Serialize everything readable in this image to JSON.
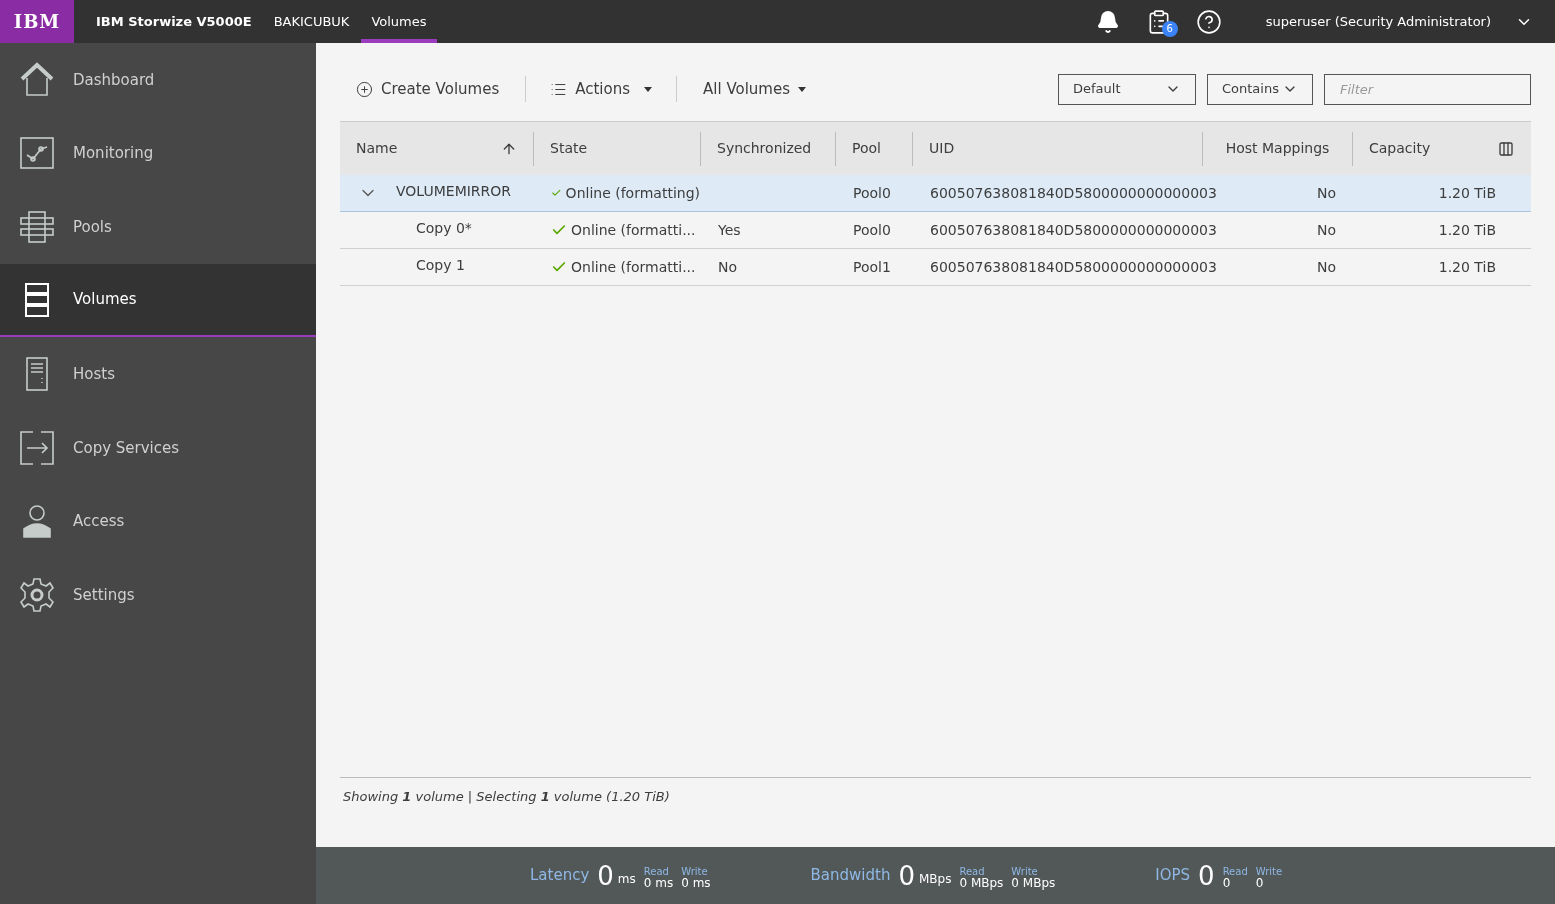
{
  "header": {
    "logo": "IBM",
    "product": "IBM Storwize V5000E",
    "system": "BAKICUBUK",
    "tabs": [
      {
        "label": "Volumes",
        "selected": true
      }
    ],
    "tasks_badge": "6",
    "user": "superuser (Security Administrator)"
  },
  "sidebar": {
    "items": [
      {
        "label": "Dashboard",
        "kind": "dashboard",
        "selected": false
      },
      {
        "label": "Monitoring",
        "kind": "monitoring",
        "selected": false
      },
      {
        "label": "Pools",
        "kind": "pools",
        "selected": false
      },
      {
        "label": "Volumes",
        "kind": "volumes",
        "selected": true
      },
      {
        "label": "Hosts",
        "kind": "hosts",
        "selected": false
      },
      {
        "label": "Copy Services",
        "kind": "copy",
        "selected": false
      },
      {
        "label": "Access",
        "kind": "access",
        "selected": false
      },
      {
        "label": "Settings",
        "kind": "settings",
        "selected": false
      }
    ]
  },
  "toolbar": {
    "create": "Create Volumes",
    "actions": "Actions",
    "view": "All Volumes",
    "preset": "Default",
    "match": "Contains",
    "filter_placeholder": "Filter"
  },
  "table": {
    "columns": [
      "Name",
      "State",
      "Synchronized",
      "Pool",
      "UID",
      "Host Mappings",
      "Capacity"
    ],
    "rows": [
      {
        "name": "VOLUMEMIRROR",
        "state": "Online (formatting)",
        "synchronized": "",
        "pool": "Pool0",
        "uid": "600507638081840D5800000000000003",
        "host_mappings": "No",
        "capacity": "1.20 TiB",
        "selected": true,
        "expanded": true,
        "children": [
          {
            "name": "Copy 0*",
            "state": "Online (formatti...",
            "synchronized": "Yes",
            "pool": "Pool0",
            "uid": "600507638081840D5800000000000003",
            "host_mappings": "No",
            "capacity": "1.20 TiB",
            "selected": false
          },
          {
            "name": "Copy 1",
            "state": "Online (formatti...",
            "synchronized": "No",
            "pool": "Pool1",
            "uid": "600507638081840D5800000000000003",
            "host_mappings": "No",
            "capacity": "1.20 TiB",
            "selected": false
          }
        ]
      }
    ]
  },
  "summary": "Showing **1** volume | Selecting **1** volume (1.20 TiB)",
  "performance": [
    {
      "label": "Latency",
      "value": "0",
      "unit": "ms",
      "read_label": "Read",
      "read_value": "0 ms",
      "write_label": "Write",
      "write_value": "0 ms"
    },
    {
      "label": "Bandwidth",
      "value": "0",
      "unit": "MBps",
      "read_label": "Read",
      "read_value": "0 MBps",
      "write_label": "Write",
      "write_value": "0 MBps"
    },
    {
      "label": "IOPS",
      "value": "0",
      "read_label": "Read",
      "read_value": "0",
      "write_label": "Write",
      "write_value": "0"
    }
  ]
}
